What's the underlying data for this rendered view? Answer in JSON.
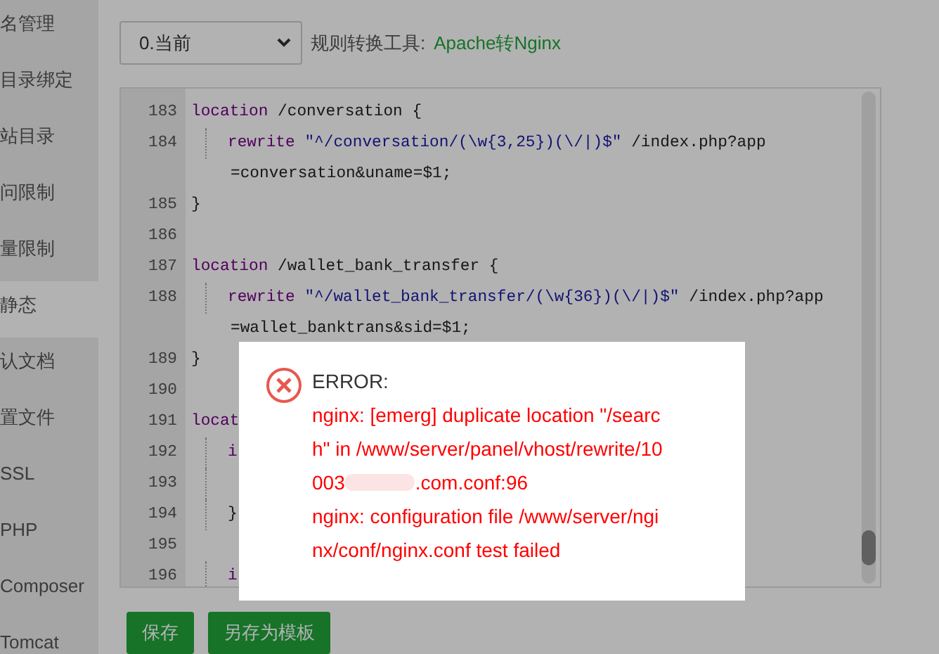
{
  "sidebar": {
    "items": [
      {
        "label": "名管理",
        "selected": false
      },
      {
        "label": "目录绑定",
        "selected": false
      },
      {
        "label": "站目录",
        "selected": false
      },
      {
        "label": "问限制",
        "selected": false
      },
      {
        "label": "量限制",
        "selected": false
      },
      {
        "label": "静态",
        "selected": true
      },
      {
        "label": "认文档",
        "selected": false
      },
      {
        "label": "置文件",
        "selected": false
      },
      {
        "label": "SSL",
        "selected": false
      },
      {
        "label": "PHP",
        "selected": false
      },
      {
        "label": "Composer",
        "selected": false
      },
      {
        "label": "Tomcat",
        "selected": false
      }
    ]
  },
  "toolbar": {
    "select_value": "0.当前",
    "converter_label": "规则转换工具:",
    "converter_link": "Apache转Nginx"
  },
  "editor": {
    "lines": [
      {
        "number": "183",
        "indent": false,
        "tokens": [
          {
            "kind": "keyword",
            "text": "location"
          },
          {
            "kind": "plain",
            "text": " /conversation {"
          }
        ]
      },
      {
        "number": "184",
        "indent": true,
        "tokens": [
          {
            "kind": "keyword",
            "text": "rewrite"
          },
          {
            "kind": "string",
            "text": "\"^/conversation/(\\w{3,25})(\\/|)$\""
          },
          {
            "kind": "plain",
            "text": " /index.php?app"
          }
        ]
      },
      {
        "indent": false,
        "tokens": [
          {
            "kind": "plain",
            "text": "=conversation&uname=$1;"
          }
        ]
      },
      {
        "number": "185",
        "indent": false,
        "tokens": [
          {
            "kind": "plain",
            "text": "}"
          }
        ]
      },
      {
        "number": "186",
        "indent": false
      },
      {
        "number": "187",
        "indent": false,
        "tokens": [
          {
            "kind": "keyword",
            "text": "location"
          },
          {
            "kind": "plain",
            "text": " /wallet_bank_transfer {"
          }
        ]
      },
      {
        "number": "188",
        "indent": true,
        "tokens": [
          {
            "kind": "keyword",
            "text": "rewrite"
          },
          {
            "kind": "string",
            "text": "\"^/wallet_bank_transfer/(\\w{36})(\\/|)$\""
          },
          {
            "kind": "plain",
            "text": " /index.php?app"
          }
        ]
      },
      {
        "indent": false,
        "tokens": [
          {
            "kind": "plain",
            "text": "=wallet_banktrans&sid=$1;"
          }
        ]
      },
      {
        "number": "189",
        "indent": false,
        "tokens": [
          {
            "kind": "plain",
            "text": "}"
          }
        ]
      },
      {
        "number": "190",
        "indent": false
      },
      {
        "number": "191",
        "indent": false,
        "tokens": [
          {
            "kind": "keyword",
            "text": "locat"
          }
        ]
      },
      {
        "number": "192",
        "indent": true,
        "tokens": [
          {
            "kind": "keyword",
            "text": "i"
          }
        ]
      },
      {
        "number": "193",
        "indent": true
      },
      {
        "number": "194",
        "indent": true,
        "tokens": [
          {
            "kind": "plain",
            "text": "}"
          }
        ]
      },
      {
        "number": "195",
        "indent": false
      },
      {
        "number": "196",
        "indent": true,
        "tokens": [
          {
            "kind": "keyword",
            "text": "i"
          }
        ]
      }
    ]
  },
  "buttons": [
    "保存",
    "另存为模板"
  ],
  "dialog": {
    "title": "ERROR:",
    "lines": [
      {
        "kind": "text",
        "text": "nginx: [emerg] duplicate location \"/searc"
      },
      {
        "kind": "text",
        "text": "h\" in /www/server/panel/vhost/rewrite/10"
      },
      {
        "kind": "redacted",
        "text": "003",
        "after": ".com.conf:96"
      },
      {
        "kind": "text",
        "text": "nginx: configuration file /www/server/ngi"
      },
      {
        "kind": "text",
        "text": "nx/conf/nginx.conf test failed"
      }
    ]
  }
}
